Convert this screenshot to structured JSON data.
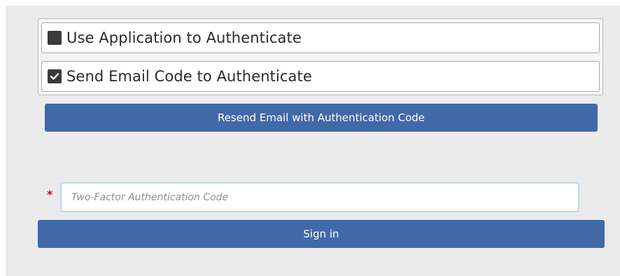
{
  "auth_options": [
    {
      "label": "Use Application to Authenticate",
      "checked": false
    },
    {
      "label": "Send Email Code to Authenticate",
      "checked": true
    }
  ],
  "resend_button": {
    "label": "Resend Email with Authentication Code"
  },
  "code_field": {
    "required_mark": "*",
    "placeholder": "Two-Factor Authentication Code",
    "value": ""
  },
  "signin_button": {
    "label": "Sign in"
  },
  "colors": {
    "button": "#4169a8",
    "background": "#ebebeb",
    "required": "#d0021b",
    "checkbox": "#3a3a3a",
    "input_border": "#c2d4ec"
  }
}
